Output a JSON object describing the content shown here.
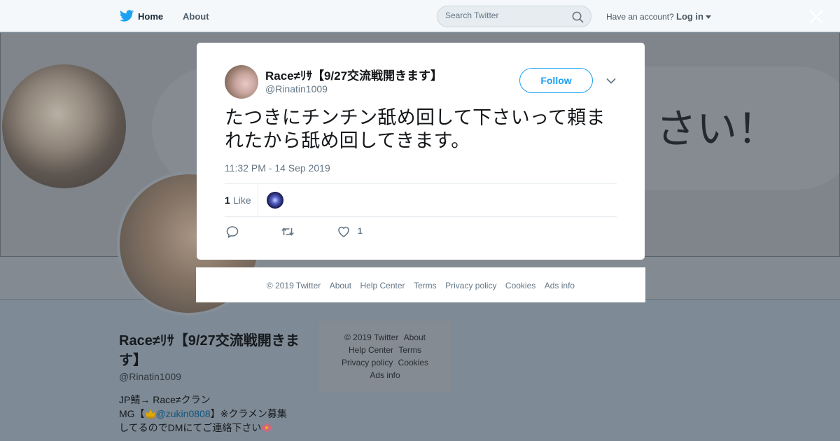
{
  "topbar": {
    "home_label": "Home",
    "about_label": "About",
    "search_placeholder": "Search Twitter",
    "have_account": "Have an account?",
    "login_label": "Log in"
  },
  "banner": {
    "text": "さい！"
  },
  "profile": {
    "name": "Race≠ﾘｻ【9/27交流戦開きます】",
    "handle": "@Rinatin1009",
    "bio_line1": "JP鯖→ Race≠クラン",
    "bio_line2_prefix": "MG【",
    "bio_mention": "@zukin0808",
    "bio_line2_suffix": "】※クラメン募集",
    "bio_line3": "してるのでDMにてご連絡下さい"
  },
  "side_footer": {
    "row1": [
      "© 2019 Twitter",
      "About"
    ],
    "row2": [
      "Help Center",
      "Terms"
    ],
    "row3": [
      "Privacy policy",
      "Cookies"
    ],
    "row4": [
      "Ads info"
    ]
  },
  "tweet": {
    "author_name": "Race≠ﾘｻ【9/27交流戦開きます】",
    "author_handle": "@Rinatin1009",
    "follow_label": "Follow",
    "text": "たつきにチンチン舐め回して下さいって頼まれたから舐め回してきます。",
    "timestamp": "11:32 PM - 14 Sep 2019",
    "like_count": "1",
    "like_label": "Like",
    "action_like_count": "1"
  },
  "modal_footer": {
    "links": [
      "© 2019 Twitter",
      "About",
      "Help Center",
      "Terms",
      "Privacy policy",
      "Cookies",
      "Ads info"
    ]
  },
  "colors": {
    "accent": "#1da1f2",
    "overlay": "#7e8a95",
    "text_secondary": "#657786"
  },
  "icons": [
    "twitter-bird-icon",
    "search-icon",
    "close-icon",
    "chevron-down-icon",
    "reply-icon",
    "retweet-icon",
    "heart-icon"
  ]
}
